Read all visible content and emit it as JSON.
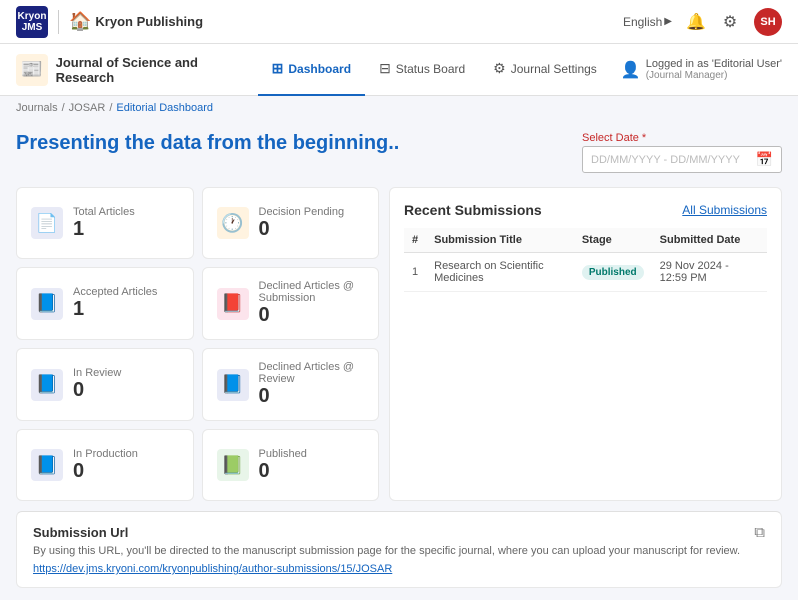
{
  "topNav": {
    "logoLine1": "Kryon",
    "logoLine2": "JMS",
    "appName": "Kryon Publishing",
    "language": "English",
    "avatarInitials": "SH"
  },
  "secondNav": {
    "journalTitle": "Journal of Science and Research",
    "tabs": [
      {
        "id": "dashboard",
        "label": "Dashboard",
        "active": true,
        "icon": "⊞"
      },
      {
        "id": "status-board",
        "label": "Status Board",
        "active": false,
        "icon": "⊟"
      },
      {
        "id": "journal-settings",
        "label": "Journal Settings",
        "active": false,
        "icon": "⚙"
      }
    ],
    "loggedInAs": "Logged in as 'Editorial User'",
    "role": "(Journal Manager)"
  },
  "breadcrumb": {
    "items": [
      "Journals",
      "JOSAR",
      "Editorial Dashboard"
    ]
  },
  "heading": "Presenting the data from the beginning..",
  "dateSelect": {
    "label": "Select Date",
    "required": true,
    "placeholder": "DD/MM/YYYY - DD/MM/YYYY"
  },
  "stats": [
    {
      "id": "total-articles",
      "label": "Total Articles",
      "value": "1",
      "iconType": "blue"
    },
    {
      "id": "decision-pending",
      "label": "Decision Pending",
      "value": "0",
      "iconType": "orange"
    },
    {
      "id": "accepted-articles",
      "label": "Accepted Articles",
      "value": "1",
      "iconType": "blue"
    },
    {
      "id": "declined-at-submission",
      "label": "Declined Articles @ Submission",
      "value": "0",
      "iconType": "red"
    },
    {
      "id": "in-review",
      "label": "In Review",
      "value": "0",
      "iconType": "blue"
    },
    {
      "id": "declined-at-review",
      "label": "Declined Articles @ Review",
      "value": "0",
      "iconType": "blue"
    },
    {
      "id": "in-production",
      "label": "In Production",
      "value": "0",
      "iconType": "blue"
    },
    {
      "id": "published",
      "label": "Published",
      "value": "0",
      "iconType": "green"
    }
  ],
  "recentSubmissions": {
    "title": "Recent Submissions",
    "allLink": "All Submissions",
    "columns": [
      "#",
      "Submission Title",
      "Stage",
      "Submitted Date"
    ],
    "rows": [
      {
        "num": "1",
        "title": "Research on Scientific Medicines",
        "stage": "Published",
        "date": "29 Nov 2024 - 12:59 PM"
      }
    ]
  },
  "submissionUrl": {
    "title": "Submission Url",
    "description": "By using this URL, you'll be directed to the manuscript submission page for the specific journal, where you can upload your manuscript for review.",
    "url": "https://dev.jms.kryoni.com/kryonpublishing/author-submissions/15/JOSAR"
  }
}
